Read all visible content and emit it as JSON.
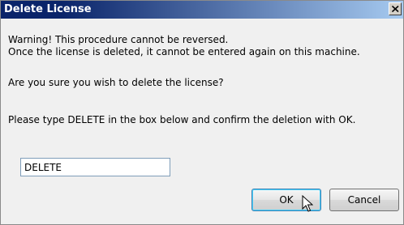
{
  "window": {
    "title": "Delete License",
    "close_icon": "close-icon"
  },
  "message": {
    "line1": "Warning! This  procedure cannot be reversed.",
    "line2": "Once the license is deleted, it cannot be entered again on this machine.",
    "line3": "Are you sure you wish to delete the license?",
    "line4": "Please type DELETE in the box below and confirm the deletion with OK."
  },
  "confirm_input": {
    "value": "DELETE",
    "placeholder": ""
  },
  "buttons": {
    "ok_label": "OK",
    "cancel_label": "Cancel"
  },
  "colors": {
    "titlebar_start": "#0a246a",
    "titlebar_end": "#a6caf0",
    "dialog_bg": "#f0f0f0"
  }
}
